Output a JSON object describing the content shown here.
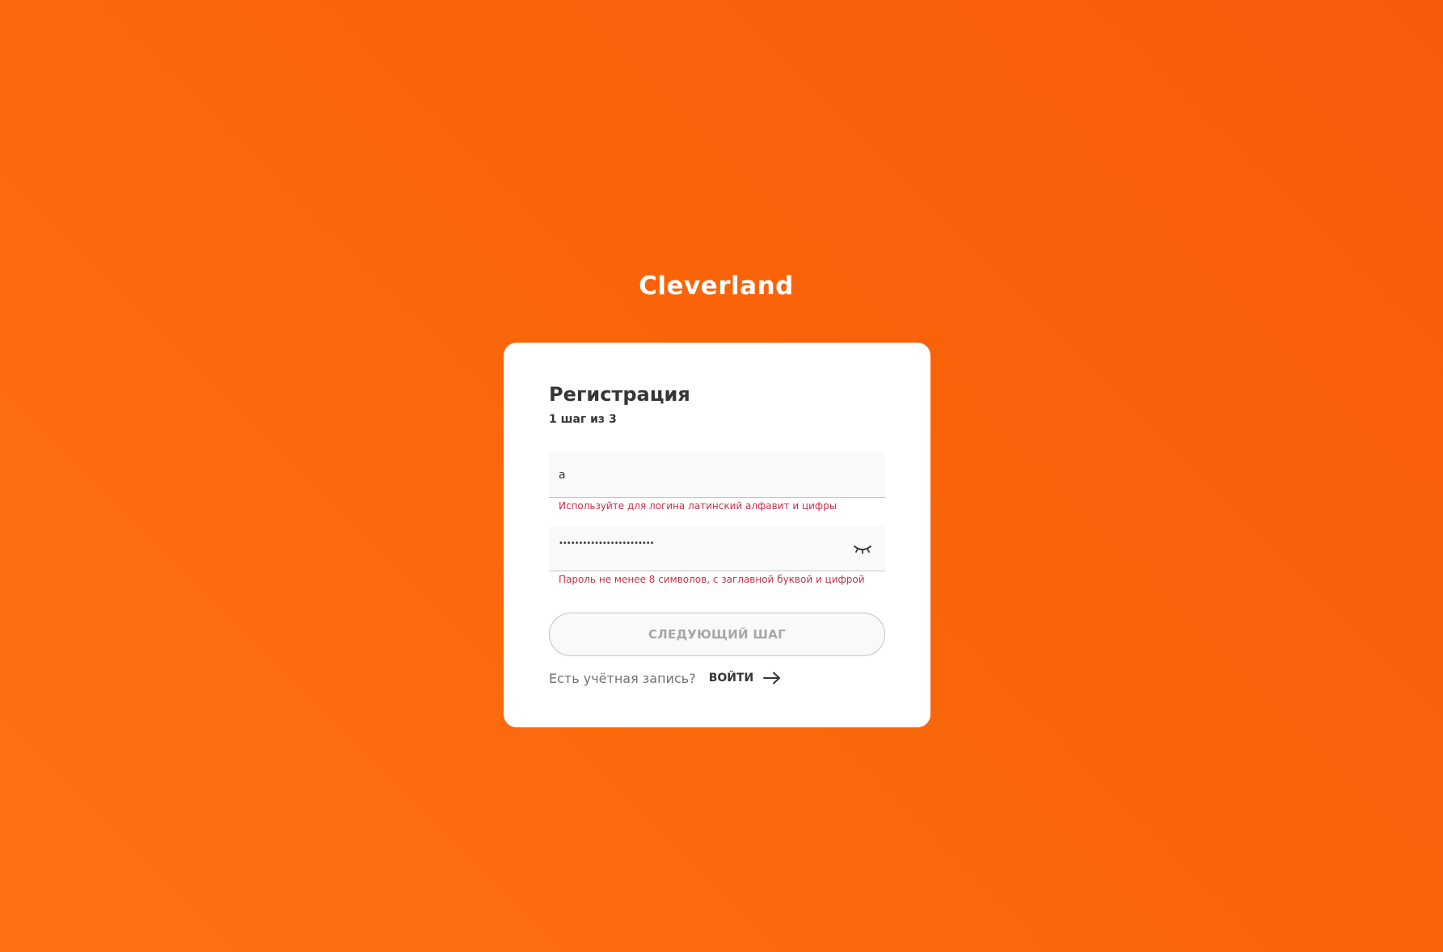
{
  "brand": {
    "name": "Cleverland"
  },
  "form": {
    "title": "Регистрация",
    "step": "1 шаг из 3",
    "login": {
      "value": "a",
      "hint": "Используйте для логина латинский алфавит и цифры"
    },
    "password": {
      "value": "••••••••••••••••••••••••",
      "hint": "Пароль не менее 8 символов, с заглавной буквой и цифрой",
      "visibility_icon": "eye-closed-icon"
    },
    "next_button_label": "СЛЕДУЮЩИЙ ШАГ",
    "footer": {
      "question": "Есть учётная запись?",
      "login_link": "ВОЙТИ",
      "arrow_icon": "arrow-right-icon"
    }
  },
  "colors": {
    "background_start": "#fd7114",
    "background_end": "#f75a0c",
    "card": "#ffffff",
    "error": "#c4314b",
    "text_primary": "#363636",
    "disabled_text": "#a7a7a7"
  }
}
